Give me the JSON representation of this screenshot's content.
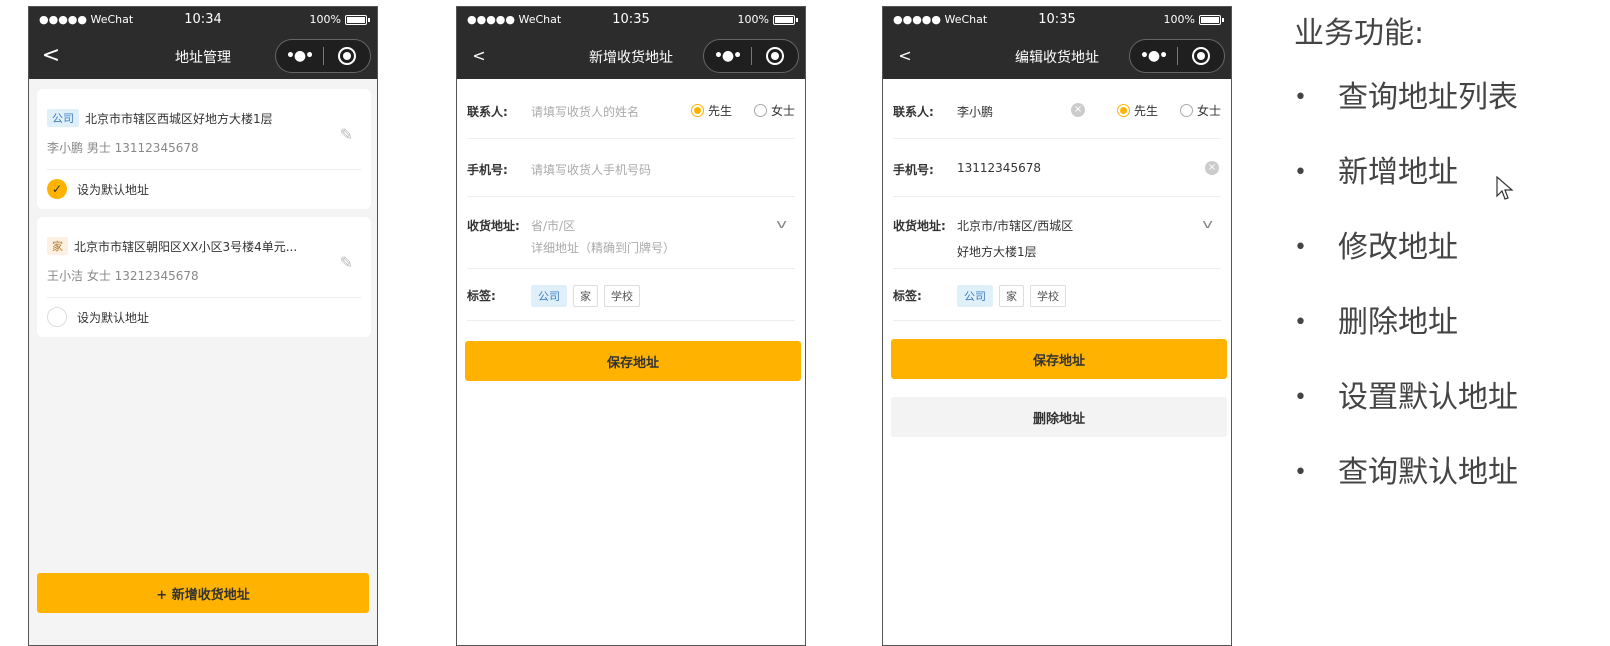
{
  "phone1": {
    "status": {
      "carrier": "●●●●● WeChat",
      "time": "10:34",
      "battery": "100%"
    },
    "nav": {
      "title": "地址管理",
      "back": "<"
    },
    "cards": [
      {
        "tag": "公司",
        "address": "北京市市辖区西城区好地方大楼1层",
        "person": "李小鹏 男士  13112345678",
        "default_label": "设为默认地址",
        "is_default": true
      },
      {
        "tag": "家",
        "address": "北京市市辖区朝阳区XX小区3号楼4单元...",
        "person": "王小洁 女士  13212345678",
        "default_label": "设为默认地址",
        "is_default": false
      }
    ],
    "add_button": "+ 新增收货地址"
  },
  "phone2": {
    "status": {
      "carrier": "●●●●● WeChat",
      "time": "10:35",
      "battery": "100%"
    },
    "nav": {
      "title": "新增收货地址",
      "back": "<"
    },
    "contact_label": "联系人:",
    "contact_placeholder": "请填写收货人的姓名",
    "male": "先生",
    "female": "女士",
    "phone_label": "手机号:",
    "phone_placeholder": "请填写收货人手机号码",
    "address_label": "收货地址:",
    "region_placeholder": "省/市/区",
    "detail_placeholder": "详细地址（精确到门牌号）",
    "tag_label": "标签:",
    "tags": [
      "公司",
      "家",
      "学校"
    ],
    "save": "保存地址"
  },
  "phone3": {
    "status": {
      "carrier": "●●●●● WeChat",
      "time": "10:35",
      "battery": "100%"
    },
    "nav": {
      "title": "编辑收货地址",
      "back": "<"
    },
    "contact_label": "联系人:",
    "contact_value": "李小鹏",
    "male": "先生",
    "female": "女士",
    "phone_label": "手机号:",
    "phone_value": "13112345678",
    "address_label": "收货地址:",
    "region_value": "北京市/市辖区/西城区",
    "detail_value": "好地方大楼1层",
    "tag_label": "标签:",
    "tags": [
      "公司",
      "家",
      "学校"
    ],
    "save": "保存地址",
    "delete": "删除地址"
  },
  "features": {
    "heading": "业务功能:",
    "items": [
      "查询地址列表",
      "新增地址",
      "修改地址",
      "删除地址",
      "设置默认地址",
      "查询默认地址"
    ]
  },
  "colors": {
    "accent": "#ffb300",
    "navbar": "#2c2c2c",
    "tag_blue": "#e0f0fb"
  }
}
